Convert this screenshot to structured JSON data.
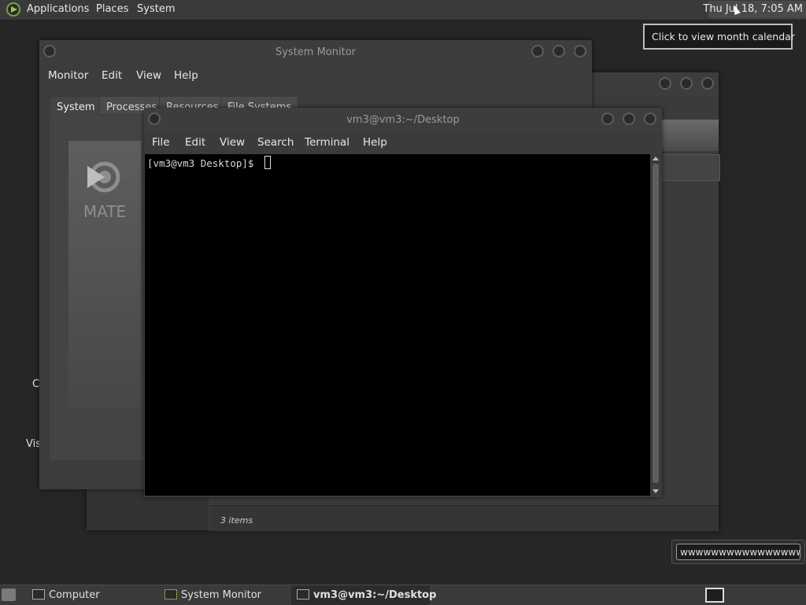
{
  "top_panel": {
    "menu": [
      "Applications",
      "Places",
      "System"
    ],
    "clock": "Thu Jul 18,  7:05 AM",
    "tooltip": "Click to view month calendar"
  },
  "file_manager_window": {
    "status": "3 items"
  },
  "system_monitor": {
    "title": "System Monitor",
    "menu": [
      "Monitor",
      "Edit",
      "View",
      "Help"
    ],
    "tabs": [
      "System",
      "Processes",
      "Resources",
      "File Systems"
    ],
    "banner_text": "MATE"
  },
  "terminal": {
    "title": "vm3@vm3:~/Desktop",
    "menu": [
      "File",
      "Edit",
      "View",
      "Search",
      "Terminal",
      "Help"
    ],
    "prompt": "[vm3@vm3 Desktop]$ "
  },
  "text_entry": {
    "value": "wwwwwwwwwwwwwwwww"
  },
  "desktop": {
    "labels": [
      "C",
      "Vis"
    ]
  },
  "taskbar": {
    "items": [
      "Computer",
      "System Monitor",
      "vm3@vm3:~/Desktop"
    ]
  }
}
